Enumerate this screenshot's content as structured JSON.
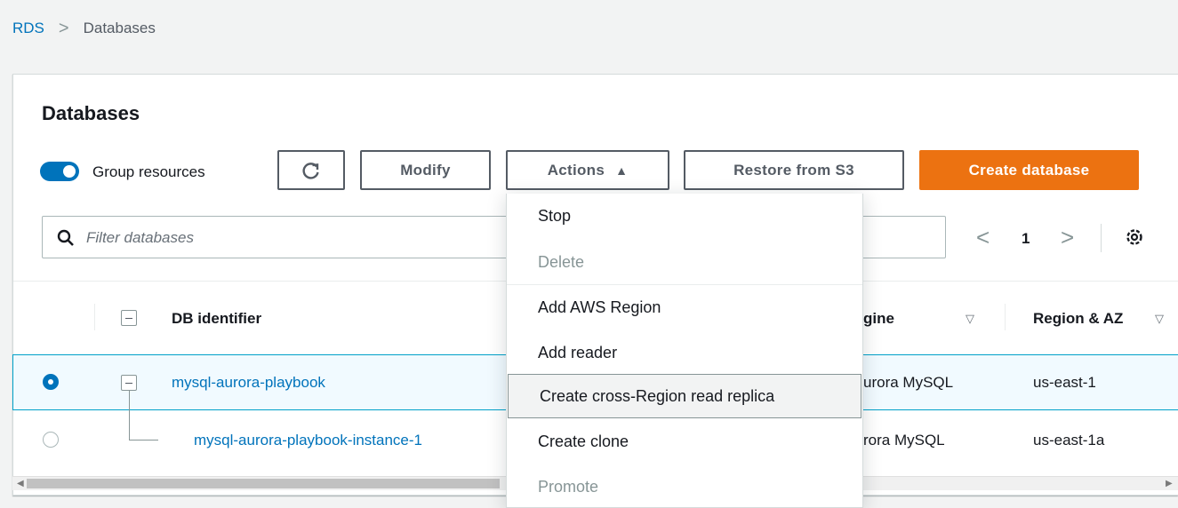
{
  "breadcrumb": {
    "root": "RDS",
    "separator": ">",
    "current": "Databases"
  },
  "panel": {
    "title": "Databases"
  },
  "toolbar": {
    "group_resources_label": "Group resources",
    "group_resources_on": true,
    "refresh_icon": "refresh-icon",
    "modify_label": "Modify",
    "actions_label": "Actions",
    "restore_label": "Restore from S3",
    "create_label": "Create database"
  },
  "search": {
    "placeholder": "Filter databases"
  },
  "pagination": {
    "prev": "<",
    "page": "1",
    "next": ">"
  },
  "table": {
    "columns": [
      "DB identifier",
      "Engine",
      "Region & AZ"
    ],
    "engine_header_visible": "gine",
    "rows": [
      {
        "identifier": "mysql-aurora-playbook",
        "engine": "Aurora MySQL",
        "engine_visible": "urora MySQL",
        "region": "us-east-1",
        "selected": true
      },
      {
        "identifier": "mysql-aurora-playbook-instance-1",
        "identifier_visible": "mysql-aurora-playbook-instance-1",
        "engine": "Aurora MySQL",
        "engine_visible": "rora MySQL",
        "region": "us-east-1a",
        "selected": false
      }
    ]
  },
  "actions_menu": {
    "items": [
      {
        "label": "Stop",
        "disabled": false
      },
      {
        "label": "Delete",
        "disabled": true
      },
      {
        "label": "Add AWS Region",
        "disabled": false
      },
      {
        "label": "Add reader",
        "disabled": false
      },
      {
        "label": "Create cross-Region read replica",
        "disabled": false,
        "hovered": true
      },
      {
        "label": "Create clone",
        "disabled": false
      },
      {
        "label": "Promote",
        "disabled": true
      }
    ]
  },
  "colors": {
    "primary": "#ec7211",
    "link": "#0073bb",
    "selected_row": "#f1faff",
    "selected_border": "#00a1c9"
  }
}
